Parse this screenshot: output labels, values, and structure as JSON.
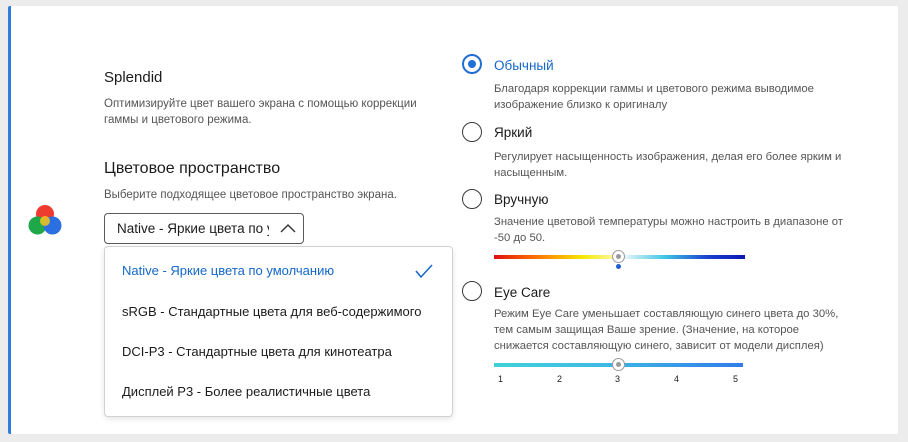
{
  "splendid": {
    "title": "Splendid",
    "description": "Оптимизируйте цвет вашего экрана с помощью коррекции гаммы и цветового режима."
  },
  "color_space": {
    "title": "Цветовое пространство",
    "description": "Выберите подходящее цветовое пространство экрана.",
    "selected_value": "Native - Яркие цвета по умолчанию",
    "options": [
      "Native - Яркие цвета по умолчанию",
      "sRGB - Стандартные цвета для веб-содержимого",
      "DCI-P3 - Стандартные цвета для кинотеатра",
      "Дисплей P3 - Более реалистичные цвета"
    ]
  },
  "modes": [
    {
      "label": "Обычный",
      "description": "Благодаря коррекции гаммы и цветового режима выводимое изображение близко к оригиналу",
      "selected": true
    },
    {
      "label": "Яркий",
      "description": "Регулирует насыщенность изображения, делая его более ярким и насыщенным.",
      "selected": false
    },
    {
      "label": "Вручную",
      "description": "Значение цветовой температуры можно настроить в диапазоне от -50 до 50.",
      "selected": false
    },
    {
      "label": "Eye Care",
      "description": "Режим Eye Care уменьшает составляющую синего цвета до 30%, тем самым защищая Ваше зрение. (Значение, на которое снижается составляющую синего, зависит от модели дисплея)",
      "selected": false
    }
  ],
  "eye_care_scale": {
    "ticks": [
      "1",
      "2",
      "3",
      "4",
      "5"
    ],
    "value": 3
  },
  "temperature_slider": {
    "value": 0,
    "min": -50,
    "max": 50
  },
  "icons": {
    "app": "splendid-color-icon",
    "chevron": "chevron-up-icon",
    "check": "checkmark-icon"
  },
  "colors": {
    "accent": "#1f6fd6",
    "card_edge": "#2f7de1",
    "background": "#ececec"
  }
}
